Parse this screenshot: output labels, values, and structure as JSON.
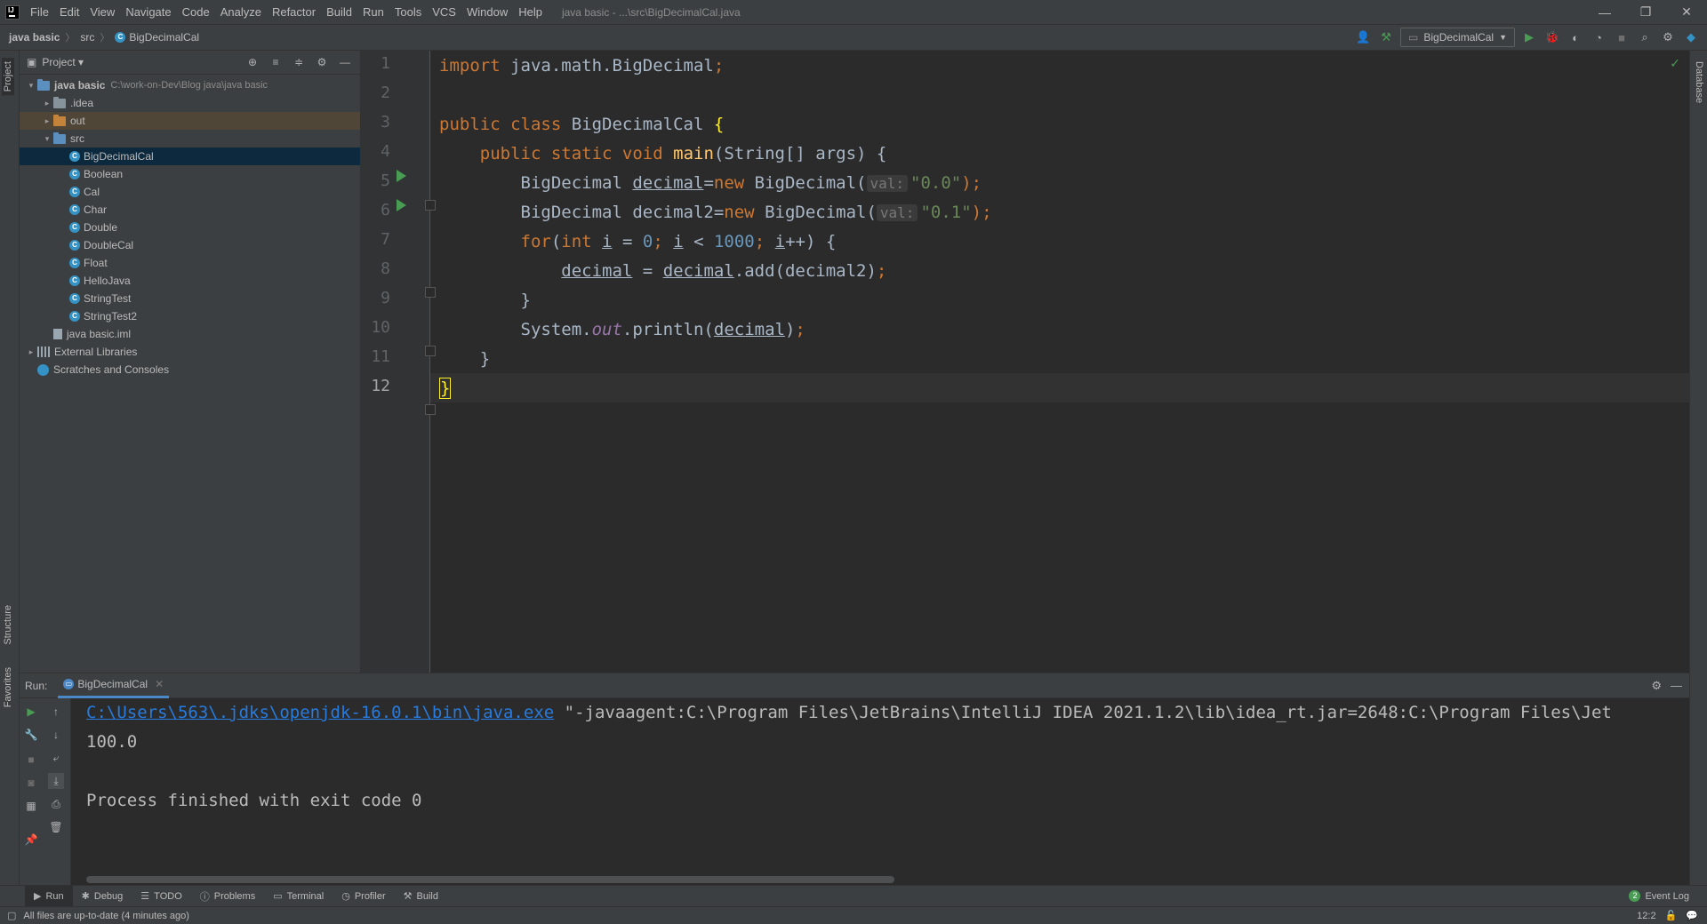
{
  "menu": {
    "items": [
      "File",
      "Edit",
      "View",
      "Navigate",
      "Code",
      "Analyze",
      "Refactor",
      "Build",
      "Run",
      "Tools",
      "VCS",
      "Window",
      "Help"
    ],
    "window_title": "java basic - ...\\src\\BigDecimalCal.java"
  },
  "window_controls": {
    "minimize": "—",
    "restore": "❐",
    "close": "✕"
  },
  "breadcrumb": {
    "project": "java basic",
    "folder": "src",
    "file": "BigDecimalCal"
  },
  "toolbar": {
    "run_config": "BigDecimalCal"
  },
  "project_panel": {
    "title": "Project",
    "tree": [
      {
        "label": "java basic",
        "path": "C:\\work-on-Dev\\Blog java\\java basic",
        "type": "folder-blue",
        "depth": 0,
        "arrow": "v"
      },
      {
        "label": ".idea",
        "type": "folder",
        "depth": 1,
        "arrow": ">"
      },
      {
        "label": "out",
        "type": "folder-orange",
        "depth": 1,
        "arrow": ">"
      },
      {
        "label": "src",
        "type": "folder-blue",
        "depth": 1,
        "arrow": "v"
      },
      {
        "label": "BigDecimalCal",
        "type": "class",
        "depth": 2,
        "selected": true
      },
      {
        "label": "Boolean",
        "type": "class",
        "depth": 2
      },
      {
        "label": "Cal",
        "type": "class",
        "depth": 2
      },
      {
        "label": "Char",
        "type": "class",
        "depth": 2
      },
      {
        "label": "Double",
        "type": "class",
        "depth": 2
      },
      {
        "label": "DoubleCal",
        "type": "class",
        "depth": 2
      },
      {
        "label": "Float",
        "type": "class",
        "depth": 2
      },
      {
        "label": "HelloJava",
        "type": "class",
        "depth": 2
      },
      {
        "label": "StringTest",
        "type": "class",
        "depth": 2
      },
      {
        "label": "StringTest2",
        "type": "class",
        "depth": 2
      },
      {
        "label": "java basic.iml",
        "type": "iml",
        "depth": 1
      },
      {
        "label": "External Libraries",
        "type": "lib",
        "depth": 0,
        "arrow": ">"
      },
      {
        "label": "Scratches and Consoles",
        "type": "scratch",
        "depth": 0
      }
    ]
  },
  "editor": {
    "line_numbers": [
      "1",
      "2",
      "3",
      "4",
      "5",
      "6",
      "7",
      "8",
      "9",
      "10",
      "11",
      "12"
    ],
    "current_line": 12,
    "code": {
      "l1_kw": "import",
      "l1_rest": " java.math.BigDecimal",
      "l1_semi": ";",
      "l3_kw": "public class",
      "l3_name": " BigDecimalCal ",
      "l3_brace": "{",
      "l4_indent": "    ",
      "l4_kw": "public static void",
      "l4_sp": " ",
      "l4_fn": "main",
      "l4_rest": "(String[] args) {",
      "l5_indent": "        ",
      "l5_type": "BigDecimal ",
      "l5_var": "decimal",
      "l5_eq": "=",
      "l5_new": "new",
      "l5_ctor": " BigDecimal(",
      "l5_hint": "val:",
      "l5_str": "\"0.0\"",
      "l5_end": ");",
      "l6_indent": "        ",
      "l6_type": "BigDecimal decimal2=",
      "l6_new": "new",
      "l6_ctor": " BigDecimal(",
      "l6_hint": "val:",
      "l6_str": "\"0.1\"",
      "l6_end": ");",
      "l7_indent": "        ",
      "l7_for": "for",
      "l7_p1": "(",
      "l7_int": "int",
      "l7_sp": " ",
      "l7_i1": "i",
      "l7_eq": " = ",
      "l7_zero": "0",
      "l7_semi1": "; ",
      "l7_i2": "i",
      "l7_lt": " < ",
      "l7_max": "1000",
      "l7_semi2": "; ",
      "l7_i3": "i",
      "l7_inc": "++) {",
      "l8_indent": "            ",
      "l8_var": "decimal",
      "l8_eq": " = ",
      "l8_var2": "decimal",
      "l8_rest": ".add(decimal2)",
      "l8_semi": ";",
      "l9_indent": "        ",
      "l9_brace": "}",
      "l10_indent": "        ",
      "l10_sys": "System.",
      "l10_out": "out",
      "l10_print": ".println(",
      "l10_var": "decimal",
      "l10_end": ")",
      "l10_semi": ";",
      "l11_indent": "    ",
      "l11_brace": "}",
      "l12_brace": "}"
    }
  },
  "run_panel": {
    "label": "Run:",
    "tab": "BigDecimalCal",
    "console": {
      "cmd_link": "C:\\Users\\563\\.jdks\\openjdk-16.0.1\\bin\\java.exe",
      "cmd_rest": " \"-javaagent:C:\\Program Files\\JetBrains\\IntelliJ IDEA 2021.1.2\\lib\\idea_rt.jar=2648:C:\\Program Files\\Jet",
      "output": "100.0",
      "blank": "",
      "finished": "Process finished with exit code 0"
    }
  },
  "bottom_tabs": [
    "Run",
    "Debug",
    "TODO",
    "Problems",
    "Terminal",
    "Profiler",
    "Build"
  ],
  "event_log": {
    "label": "Event Log",
    "count": "2"
  },
  "status": {
    "message": "All files are up-to-date (4 minutes ago)",
    "position": "12:2"
  },
  "stripes": {
    "project": "Project",
    "structure": "Structure",
    "favorites": "Favorites",
    "database": "Database"
  }
}
